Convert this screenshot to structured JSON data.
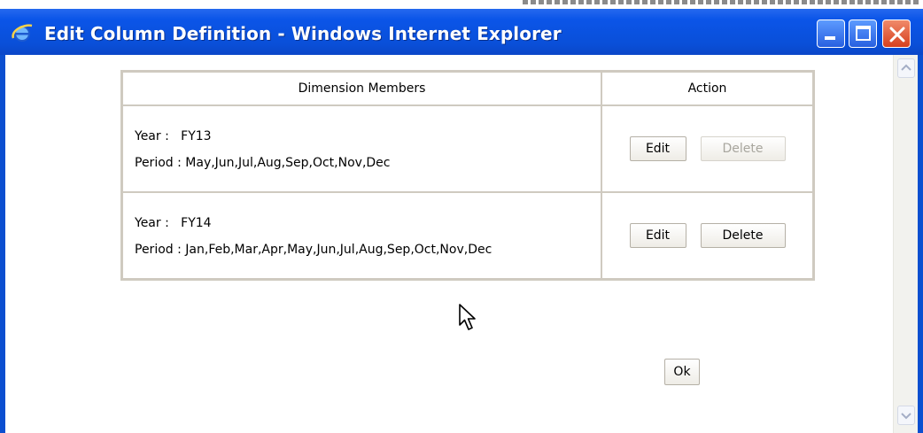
{
  "window": {
    "title": "Edit Column Definition - Windows Internet Explorer",
    "icon": "ie-icon",
    "controls": [
      "minimize-icon",
      "maximize-icon",
      "close-icon"
    ]
  },
  "table": {
    "headers": {
      "members": "Dimension Members",
      "action": "Action"
    },
    "rows": [
      {
        "year_label": "Year :",
        "year_value": "FY13",
        "period_label": "Period :",
        "period_value": "May,Jun,Jul,Aug,Sep,Oct,Nov,Dec",
        "edit_label": "Edit",
        "delete_label": "Delete",
        "delete_enabled": false
      },
      {
        "year_label": "Year :",
        "year_value": "FY14",
        "period_label": "Period :",
        "period_value": "Jan,Feb,Mar,Apr,May,Jun,Jul,Aug,Sep,Oct,Nov,Dec",
        "edit_label": "Edit",
        "delete_label": "Delete",
        "delete_enabled": true
      }
    ]
  },
  "ok_label": "Ok",
  "colors": {
    "titlebar": "#0b55e8",
    "close_button": "#d6401e",
    "table_border": "#cfcac0",
    "disabled_text": "#a8a69e"
  }
}
